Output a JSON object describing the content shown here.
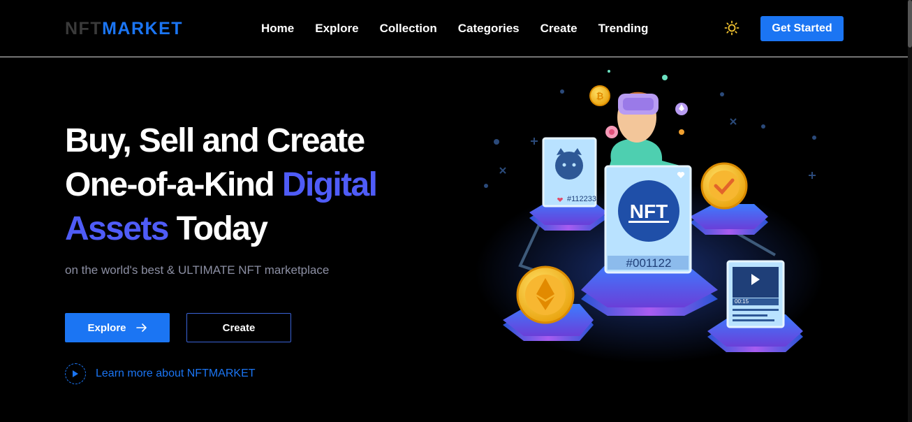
{
  "brand": {
    "part1": "NFT",
    "part2": "MARKET"
  },
  "nav": {
    "items": [
      "Home",
      "Explore",
      "Collection",
      "Categories",
      "Create",
      "Trending"
    ]
  },
  "header": {
    "theme_icon": "sun-icon",
    "cta_label": "Get Started"
  },
  "hero": {
    "line1": "Buy, Sell and Create",
    "line2_a": "One-of-a-Kind ",
    "line2_b": "Digital",
    "line3_a": "Assets",
    "line3_b": " Today",
    "subtitle": "on the world's best & ULTIMATE NFT marketplace",
    "explore_label": "Explore",
    "create_label": "Create",
    "learn_more": "Learn more about NFTMARKET"
  },
  "illustration": {
    "main_card_badge": "NFT",
    "main_card_id": "#001122",
    "small_card_id": "#112233",
    "video_time": "00:15"
  },
  "colors": {
    "accent": "#1b75f3",
    "highlight": "#4f5cf7",
    "background": "#000000"
  }
}
